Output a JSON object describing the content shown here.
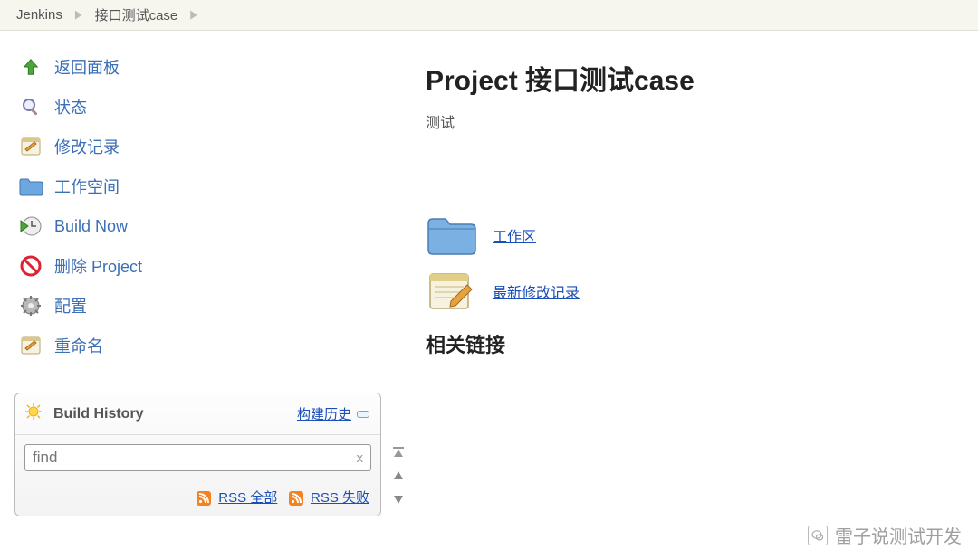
{
  "breadcrumb": {
    "root": "Jenkins",
    "project": "接口测试case"
  },
  "sidebar": {
    "items": [
      {
        "label": "返回面板",
        "icon": "up-arrow"
      },
      {
        "label": "状态",
        "icon": "magnifier"
      },
      {
        "label": "修改记录",
        "icon": "notepad"
      },
      {
        "label": "工作空间",
        "icon": "folder"
      },
      {
        "label": "Build Now",
        "icon": "play-clock"
      },
      {
        "label": "删除 Project",
        "icon": "no-entry"
      },
      {
        "label": "配置",
        "icon": "gear"
      },
      {
        "label": "重命名",
        "icon": "notepad"
      }
    ]
  },
  "buildHistory": {
    "title": "Build History",
    "trendLink": "构建历史",
    "findPlaceholder": "find",
    "clearGlyph": "x",
    "rssAll": "RSS 全部",
    "rssFailed": "RSS 失败"
  },
  "content": {
    "title": "Project 接口测试case",
    "description": "测试",
    "workspaceLink": "工作区",
    "changesLink": "最新修改记录",
    "relatedLinksHeading": "相关链接"
  },
  "watermark": {
    "text": "雷子说测试开发"
  }
}
